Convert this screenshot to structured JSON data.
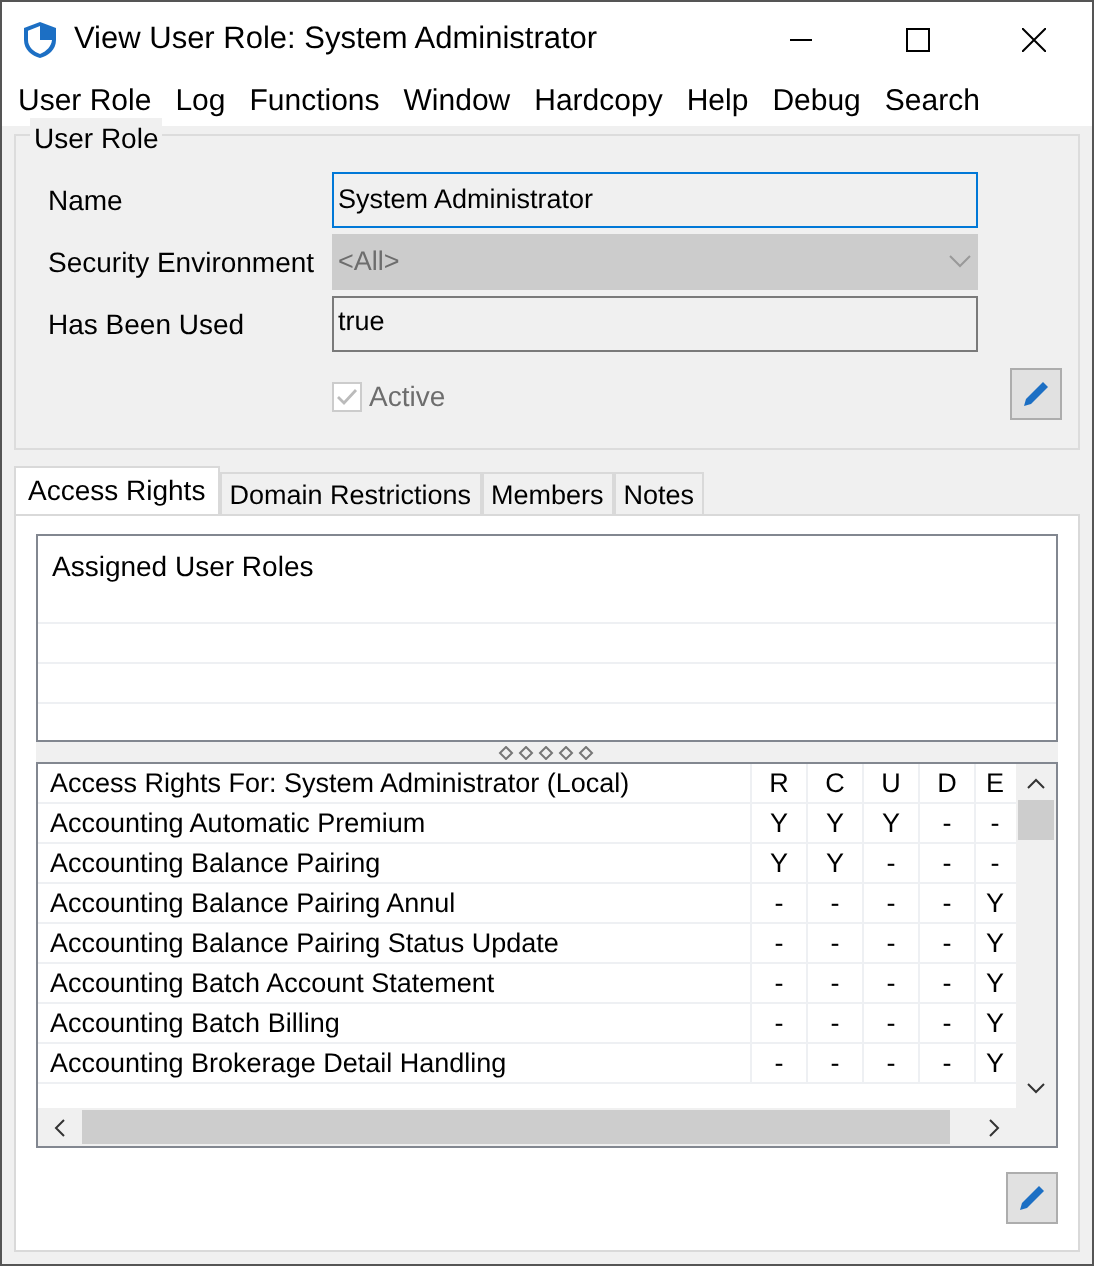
{
  "window": {
    "title": "View User Role: System Administrator"
  },
  "menu": [
    "User Role",
    "Log",
    "Functions",
    "Window",
    "Hardcopy",
    "Help",
    "Debug",
    "Search"
  ],
  "user_role": {
    "legend": "User Role",
    "fields": [
      {
        "label": "Name",
        "value": "System Administrator",
        "kind": "text",
        "focused": true,
        "disabled": false
      },
      {
        "label": "Security Environment",
        "value": "<All>",
        "kind": "select",
        "focused": false,
        "disabled": true
      },
      {
        "label": "Has Been Used",
        "value": "true",
        "kind": "text",
        "focused": false,
        "disabled": false
      }
    ],
    "active": {
      "label": "Active",
      "checked": true,
      "disabled": true
    }
  },
  "tabs": [
    {
      "label": "Access Rights",
      "selected": true
    },
    {
      "label": "Domain Restrictions",
      "selected": false
    },
    {
      "label": "Members",
      "selected": false
    },
    {
      "label": "Notes",
      "selected": false
    }
  ],
  "assigned_roles": {
    "title": "Assigned User Roles"
  },
  "access_rights": {
    "columns": [
      "Access Rights For: System Administrator (Local)",
      "R",
      "C",
      "U",
      "D",
      "E"
    ],
    "rows": [
      {
        "name": "Accounting Automatic Premium",
        "values": [
          "Y",
          "Y",
          "Y",
          "-",
          "-"
        ]
      },
      {
        "name": "Accounting Balance Pairing",
        "values": [
          "Y",
          "Y",
          "-",
          "-",
          "-"
        ]
      },
      {
        "name": "Accounting Balance Pairing Annul",
        "values": [
          "-",
          "-",
          "-",
          "-",
          "Y"
        ]
      },
      {
        "name": "Accounting Balance Pairing Status Update",
        "values": [
          "-",
          "-",
          "-",
          "-",
          "Y"
        ]
      },
      {
        "name": "Accounting Batch Account Statement",
        "values": [
          "-",
          "-",
          "-",
          "-",
          "Y"
        ]
      },
      {
        "name": "Accounting Batch Billing",
        "values": [
          "-",
          "-",
          "-",
          "-",
          "Y"
        ]
      },
      {
        "name": "Accounting Brokerage Detail Handling",
        "values": [
          "-",
          "-",
          "-",
          "-",
          "Y"
        ]
      }
    ]
  }
}
